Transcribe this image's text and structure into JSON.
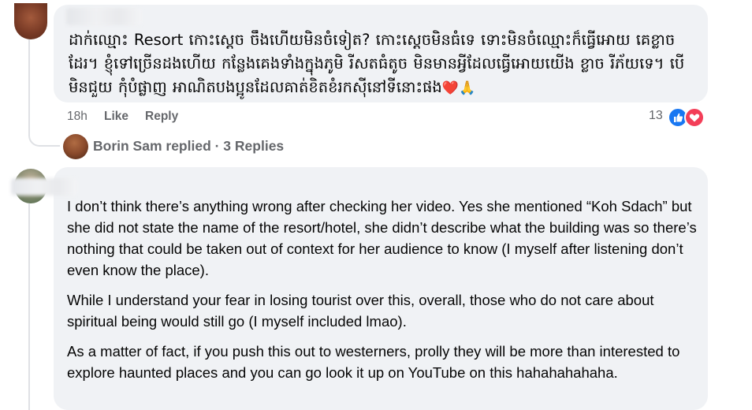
{
  "comment1": {
    "author_name": "",
    "text_khmer": "ដាក់ឈ្មោះ Resort កោះស្តេច ចឹងហើយមិនចំទៀត? កោះស្តេចមិនធំទេ ទោះមិនចំឈ្មោះក៏ធ្វើអោយ គេខ្លាចដែរ។ ខ្ញុំទៅច្រើនដងហើយ កន្លែងគេងទាំងក្នុងភូមិ រីសតធំតូច មិនមានអ្វីដែលធ្វើអោយយើង ខ្លាច រីភ័យទេ។ បើមិនជួយ កុំបំផ្លាញ អាណិតបងប្អូនដែលគាត់ខិតខំរកស៊ីនៅទីនោះផង",
    "text_emoji": "❤️🙏",
    "time": "18h",
    "like_label": "Like",
    "reply_label": "Reply",
    "reaction_count": "13",
    "reaction_colors": {
      "like": "#1877f2",
      "love": "#f33e58"
    }
  },
  "replies_row": {
    "text": "Borin Sam replied · 3 Replies"
  },
  "comment2": {
    "author_name": "",
    "paragraphs": [
      "I don’t think there’s anything wrong after checking her video. Yes she mentioned “Koh Sdach” but she did not state the name of the resort/hotel, she didn’t describe what the building was so there’s nothing that could be taken out of context for her audience to know (I myself after listening don’t even know the place).",
      "While I understand your fear in losing tourist over this, overall, those who do not care about spiritual being would still go (I myself included lmao).",
      "As a matter of fact, if you push this out to westerners, prolly they will be more than interested to explore haunted places and you can go look it up on YouTube on this hahahahahaha."
    ]
  }
}
